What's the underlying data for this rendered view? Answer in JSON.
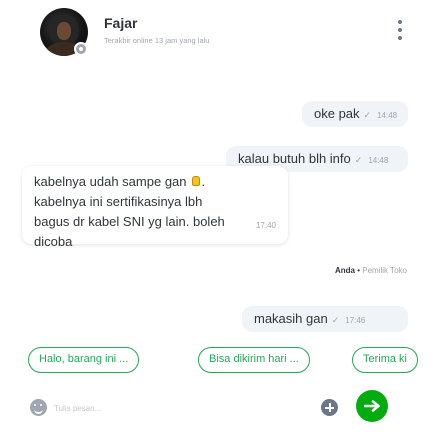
{
  "header": {
    "name": "Fajar",
    "status": "Terakhir online 13 jam yang lalu"
  },
  "messages": [
    {
      "direction": "out",
      "text": "oke pak",
      "time": "14:48",
      "read": true
    },
    {
      "direction": "out",
      "text": "kalau butuh blh info",
      "time": "14:48",
      "read": true
    },
    {
      "direction": "in",
      "lines": [
        "kabelnya udah sampe gan",
        "kabelnya ini sertifikasinya lbh",
        "bagus dr kabel SNI yg lain. boleh",
        "dicoba"
      ],
      "time": "17:40",
      "emoji": "thumbs-up"
    },
    {
      "direction": "out",
      "text": "makasih gan",
      "time": "17:46",
      "read": true
    }
  ],
  "sender_label": {
    "who": "Anda",
    "separator": "•",
    "role": "Pemilik Toko"
  },
  "quick_replies": [
    "Halo, barang ini ...",
    "Bisa dikirim hari ...",
    "Terima ki"
  ],
  "composer": {
    "placeholder": "Tulis pesan...",
    "value": ""
  },
  "icons": {
    "menu": "kebab-menu-icon",
    "emoji": "smiley-icon",
    "attach": "plus-circle-icon",
    "send": "send-arrow-icon",
    "check": "check-icon"
  },
  "colors": {
    "brand": "#03ac0e",
    "chip_border": "#22a958",
    "bubble_out": "#f0f3f7",
    "muted_text": "#9fa6b0",
    "text": "#31353b"
  }
}
